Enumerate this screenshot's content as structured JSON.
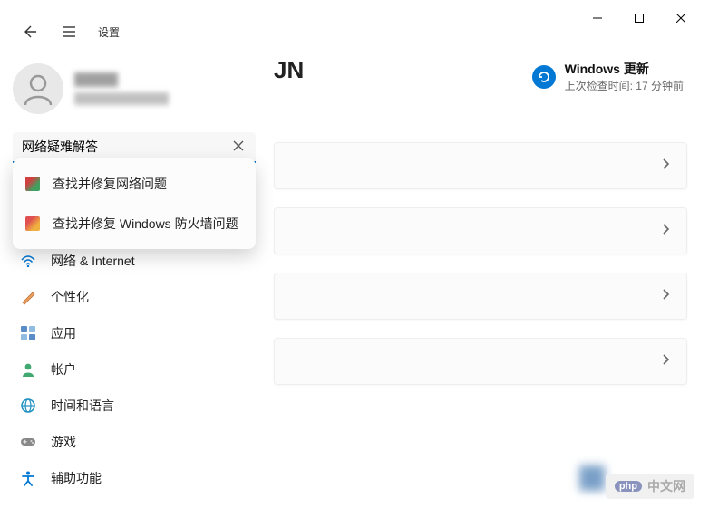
{
  "window": {
    "title": "设置"
  },
  "search": {
    "value": "网络疑难解答"
  },
  "suggestions": [
    {
      "label": "查找并修复网络问题"
    },
    {
      "label": "查找并修复 Windows 防火墙问题"
    }
  ],
  "sidebar": {
    "items": [
      {
        "label": "网络 & Internet",
        "icon": "wifi"
      },
      {
        "label": "个性化",
        "icon": "brush"
      },
      {
        "label": "应用",
        "icon": "apps"
      },
      {
        "label": "帐户",
        "icon": "person"
      },
      {
        "label": "时间和语言",
        "icon": "globe"
      },
      {
        "label": "游戏",
        "icon": "gamepad"
      },
      {
        "label": "辅助功能",
        "icon": "accessibility"
      }
    ]
  },
  "main": {
    "title_visible_suffix": "JN",
    "windows_update": {
      "title": "Windows 更新",
      "subtitle": "上次检查时间: 17 分钟前"
    }
  },
  "watermark": {
    "text": "中文网",
    "brand": "php"
  }
}
